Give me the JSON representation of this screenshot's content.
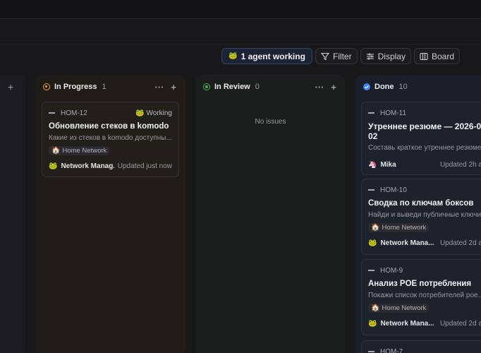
{
  "toolbar": {
    "agent_label": "1 agent working",
    "filter_label": "Filter",
    "display_label": "Display",
    "board_label": "Board"
  },
  "columns": [
    {
      "title": "In Progress",
      "count": "1",
      "color": "#f0a23a"
    },
    {
      "title": "In Review",
      "count": "0",
      "color": "#4caf50",
      "empty_text": "No issues"
    },
    {
      "title": "Done",
      "count": "10",
      "color": "#3b82f6"
    }
  ],
  "in_progress_card": {
    "id": "HOM-12",
    "status": "Working",
    "title": "Обновление стеков в komodo",
    "desc": "Какие из стеков в komodo доступны...",
    "tag": "Home Network",
    "assignee": "Network Manag...",
    "updated": "Updated just now"
  },
  "done_cards": [
    {
      "id": "HOM-11",
      "title_line1": "Утреннее резюме — 2026-09-",
      "title_line2": "02",
      "desc": "Составь краткое утреннее резюме",
      "assignee": "Mika",
      "updated": "Updated 2h a"
    },
    {
      "id": "HOM-10",
      "title": "Сводка по ключам боксов",
      "desc": "Найди и выведи публичные ключи...",
      "tag": "Home Network",
      "assignee": "Network Mana...",
      "updated": "Updated 2d a"
    },
    {
      "id": "HOM-9",
      "title": "Анализ POE потребления",
      "desc": "Покажи список потребителей рое...",
      "tag": "Home Network",
      "assignee": "Network Mana...",
      "updated": "Updated 2d a"
    },
    {
      "id": "HOM-7"
    }
  ],
  "icons": {
    "agent": "frog-icon",
    "filter": "filter-icon",
    "display": "display-icon",
    "board": "board-icon",
    "tag": "house-icon",
    "mika": "unicorn-icon"
  }
}
